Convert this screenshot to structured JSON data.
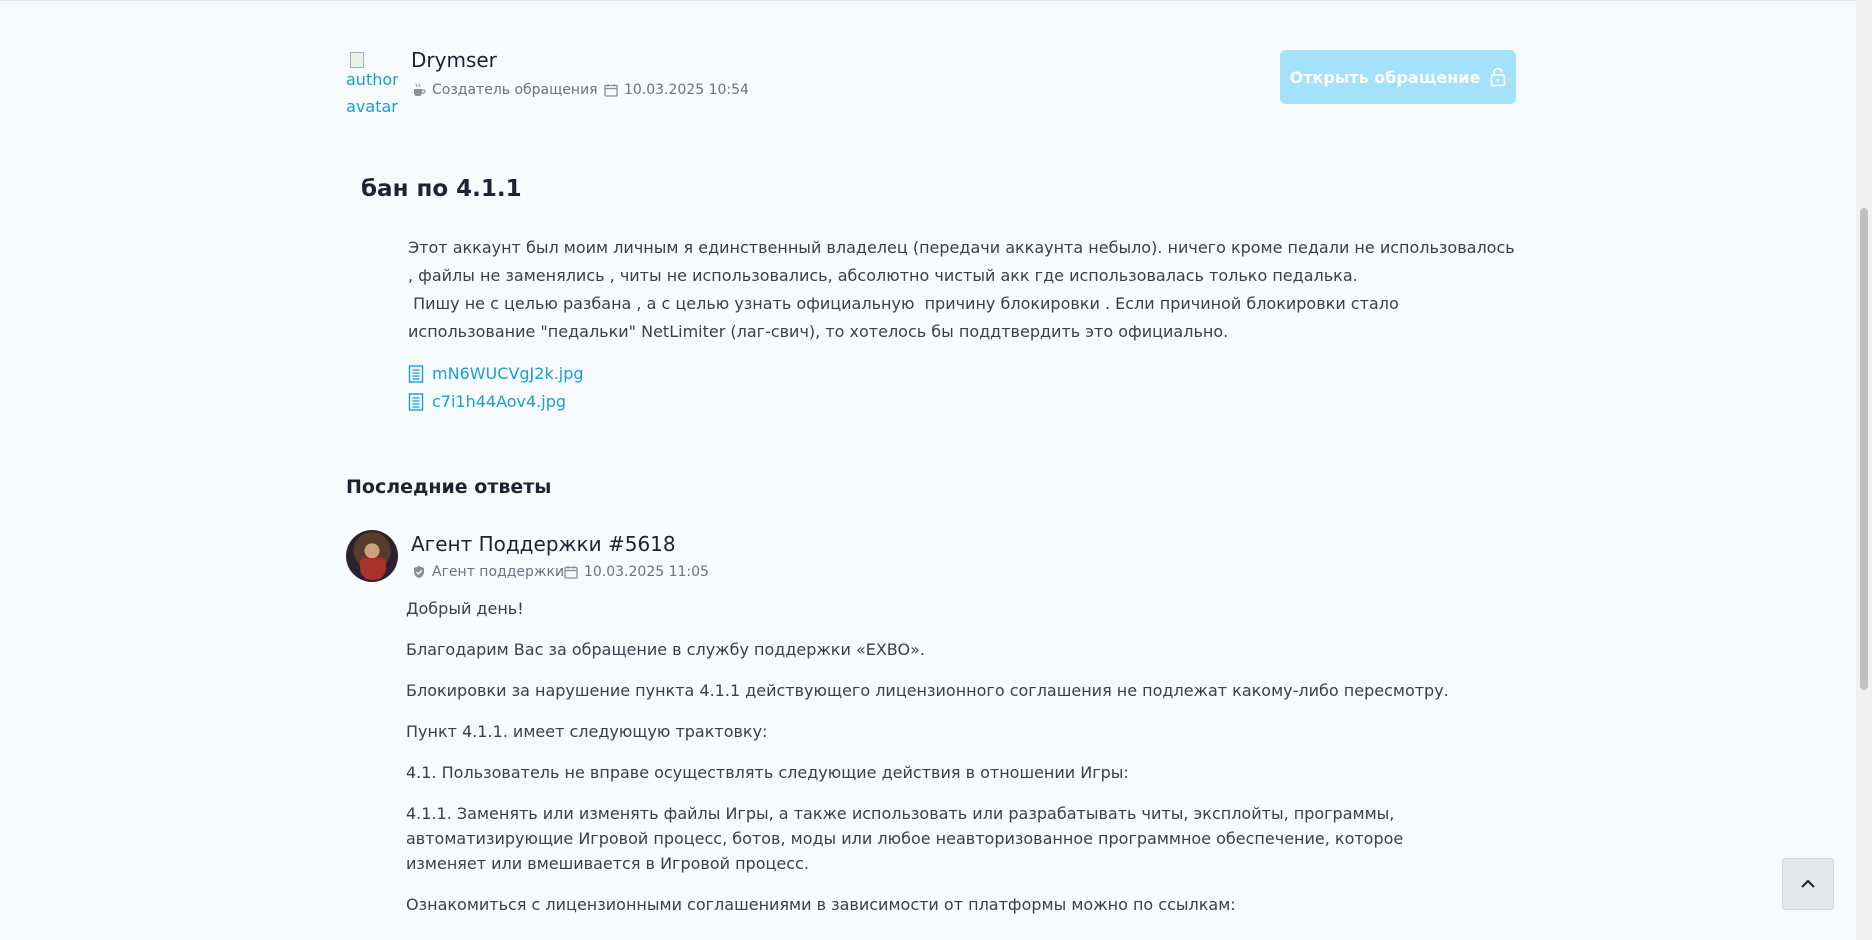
{
  "author": {
    "avatar_alt": "author avatar",
    "name": "Drymser",
    "role": "Создатель обращения",
    "date": "10.03.2025 10:54"
  },
  "actions": {
    "open_button_label": "Открыть обращение"
  },
  "ticket": {
    "title": "бан по 4.1.1",
    "body": [
      "Этот аккаунт был моим личным я единственный владелец (передачи аккаунта небыло). ничего кроме педали не использовалось , файлы не заменялись , читы не использовались, абсолютно чистый акк где использовалась только педалька.",
      " Пишу не с целью разбана , а с целью узнать официальную  причину блокировки . Если причиной блокировки стало использование \"педальки\" NetLimiter (лаг-свич), то хотелось бы поддтвердить это официально."
    ],
    "attachments": [
      "mN6WUCVgJ2k.jpg",
      "c7i1h44Aov4.jpg"
    ]
  },
  "replies_section": {
    "title": "Последние ответы"
  },
  "reply": {
    "name": "Агент Поддержки #5618",
    "role": "Агент поддержки",
    "date": "10.03.2025 11:05",
    "paragraphs": [
      "Добрый день!",
      "Благодарим Вас за обращение в службу поддержки «EXBO».",
      "Блокировки за нарушение пункта 4.1.1 действующего лицензионного соглашения не подлежат какому-либо пересмотру.",
      "Пункт 4.1.1. имеет следующую трактовку:",
      "4.1. Пользователь не вправе осуществлять следующие действия в отношении Игры:",
      "4.1.1. Заменять или изменять файлы Игры, а также использовать или разрабатывать читы, эксплойты, программы, автоматизирующие Игровой процесс, ботов, моды или любое неавторизованное программное обеспечение, которое изменяет или вмешивается в Игровой процесс.",
      "Ознакомиться с лицензионными соглашениями в зависимости от платформы можно по ссылкам:"
    ]
  },
  "colors": {
    "background": "#f7fbfd",
    "accent_link": "#1a9fd0",
    "open_button_bg": "#a4e2fb"
  },
  "icons": {
    "author_role": "coffee-cup-icon",
    "date": "calendar-icon",
    "open_button": "lock-icon",
    "attachment": "document-icon",
    "reply_role": "shield-icon",
    "scroll_top": "chevron-up-icon"
  }
}
